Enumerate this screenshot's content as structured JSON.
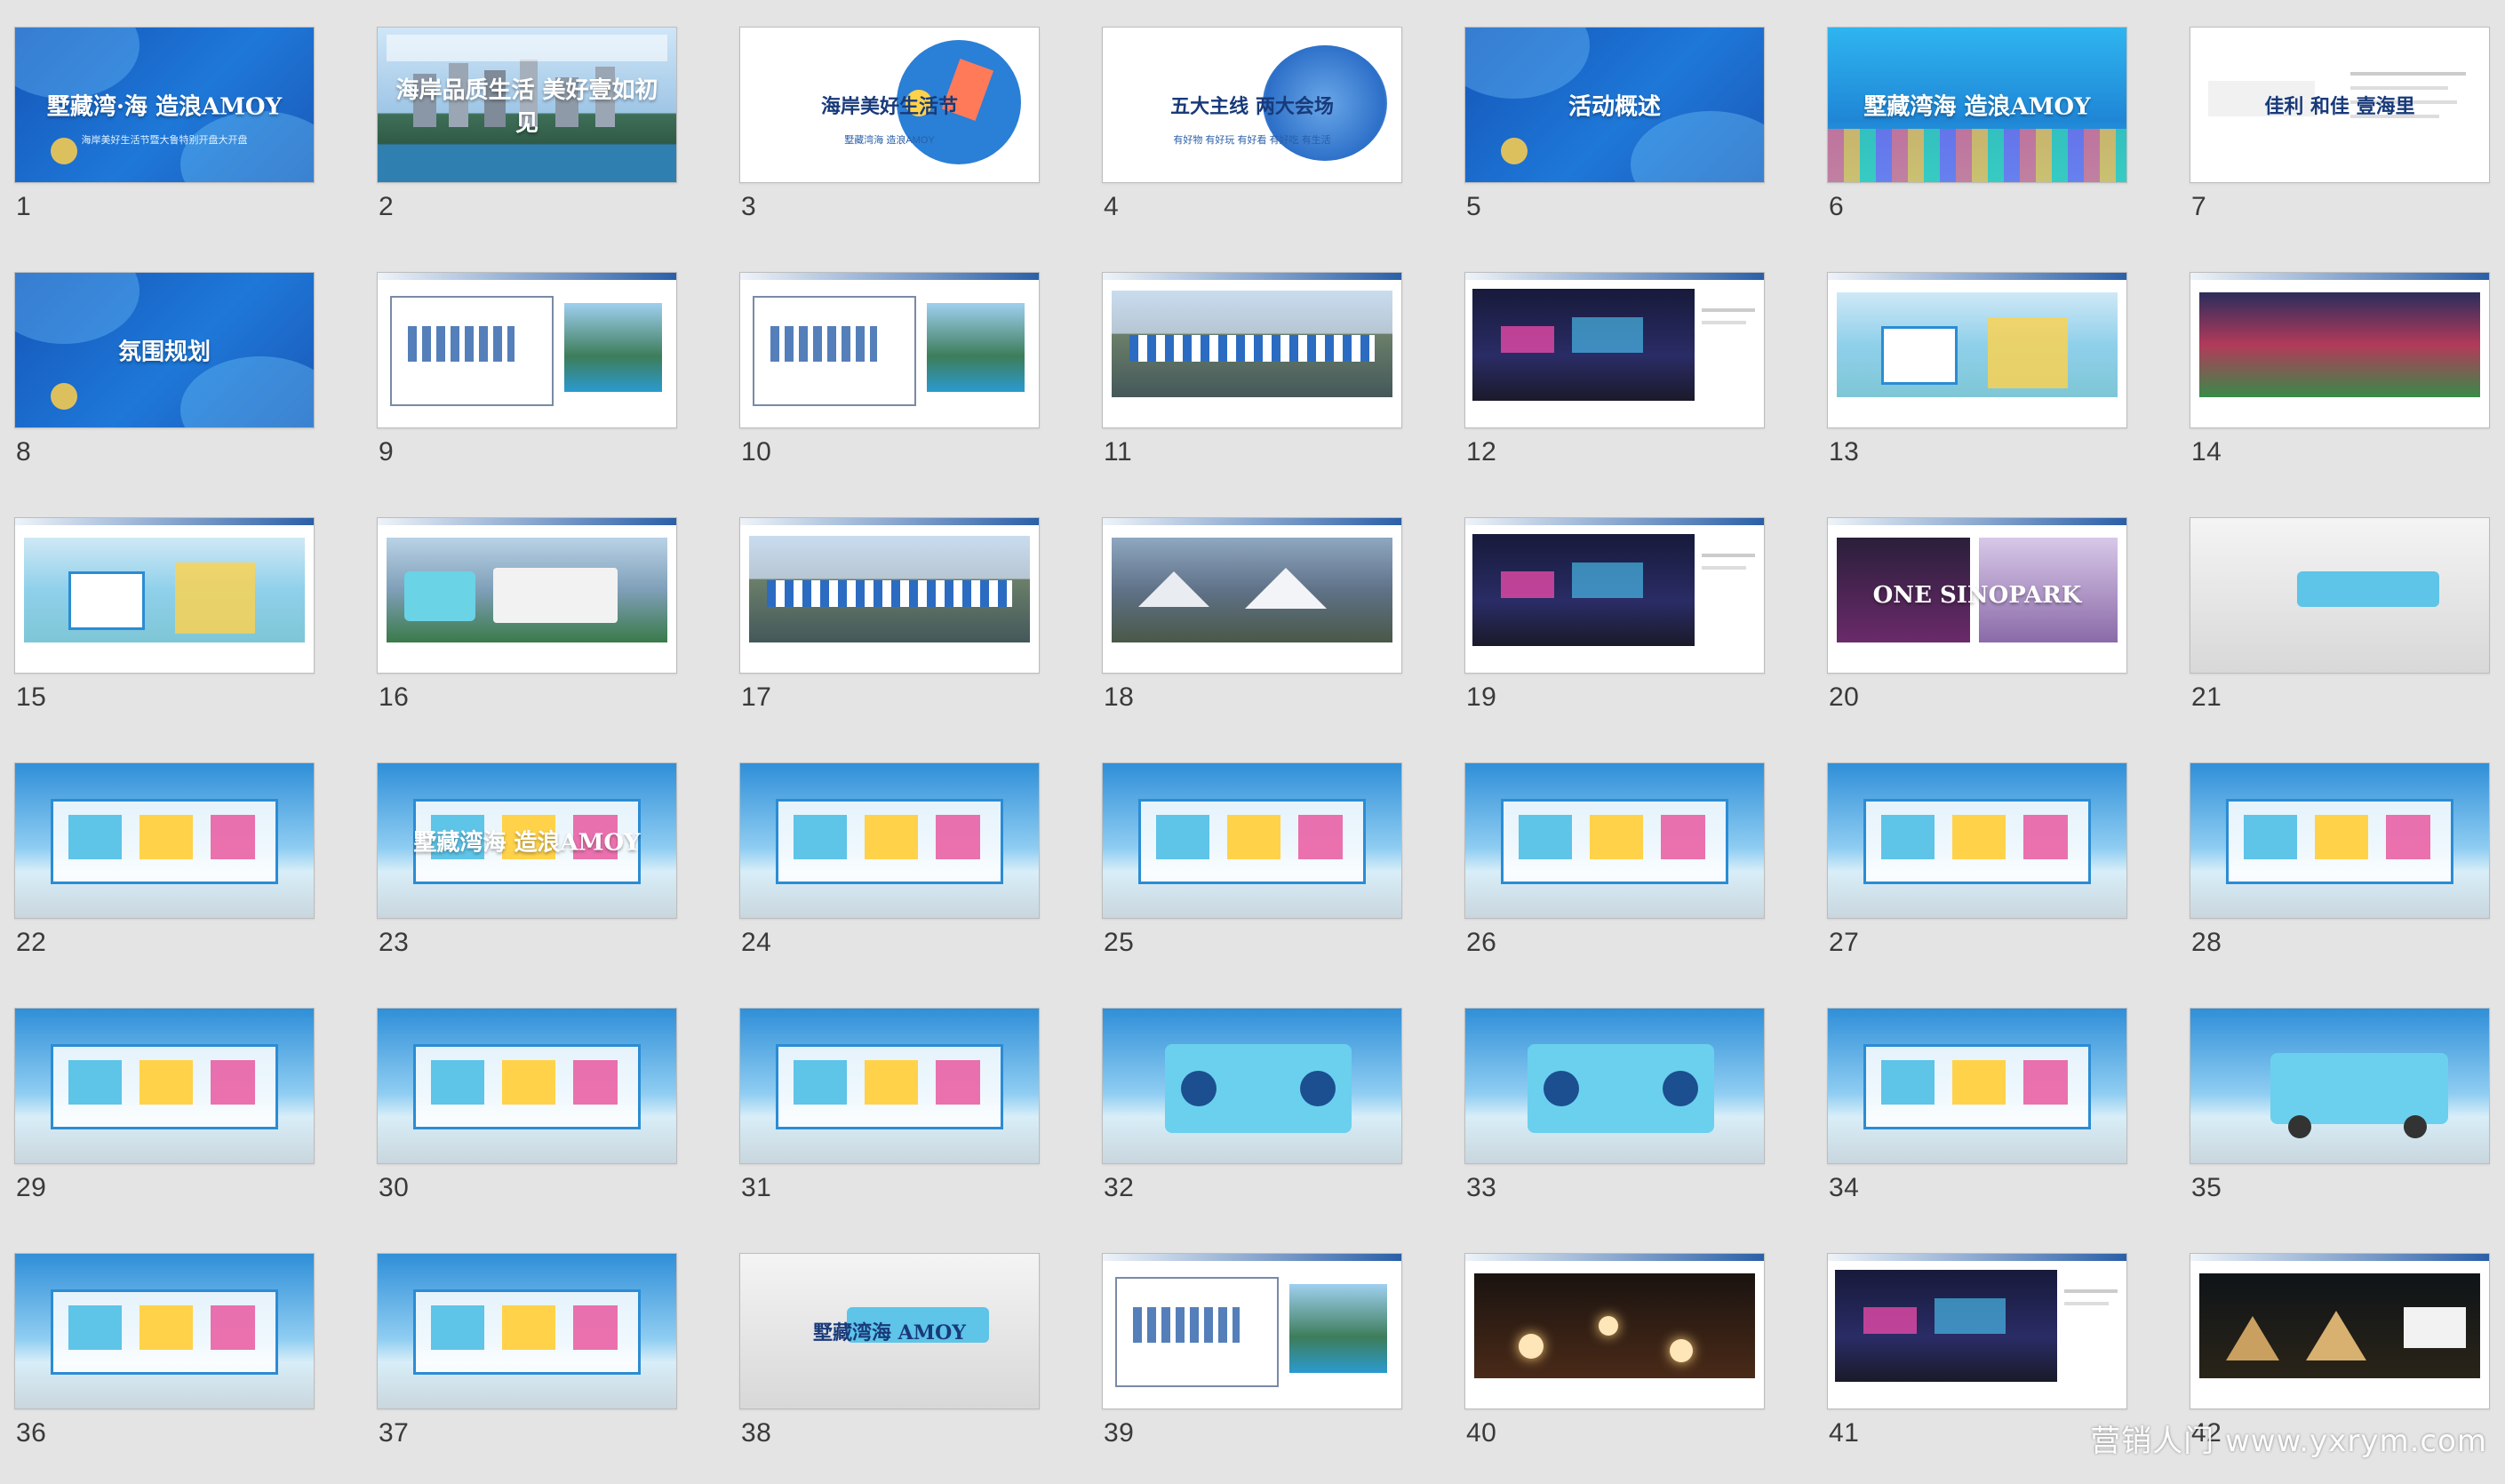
{
  "watermark": "营销人门 www.yxrym.com",
  "colors": {
    "background": "#e4e4e4",
    "brand_blue": "#1b63c6",
    "sky": "#3e9fe0",
    "sea": "#3fb9d8"
  },
  "slides": [
    {
      "number": "1",
      "title": "墅藏湾·海 造浪AMOY",
      "subtitle": "海岸美好生活节暨大鲁特别开盘大开盘",
      "style": "blue"
    },
    {
      "number": "2",
      "title": "海岸品质生活 美好壹如初见",
      "subtitle": "",
      "style": "photo-city"
    },
    {
      "number": "3",
      "title": "海岸美好生活节",
      "subtitle": "墅藏湾海 造浪AMOY",
      "style": "white-art"
    },
    {
      "number": "4",
      "title": "五大主线 两大会场",
      "subtitle": "有好物 有好玩 有好看 有好吃 有生活",
      "style": "white-text"
    },
    {
      "number": "5",
      "title": "活动概述",
      "subtitle": "",
      "style": "blue"
    },
    {
      "number": "6",
      "title": "墅藏湾海 造浪AMOY",
      "subtitle": "",
      "style": "cyan"
    },
    {
      "number": "7",
      "title": "佳利 和佳 壹海里",
      "subtitle": "",
      "style": "white-doc"
    },
    {
      "number": "8",
      "title": "氛围规划",
      "subtitle": "",
      "style": "blue"
    },
    {
      "number": "9",
      "title": "",
      "subtitle": "",
      "style": "plan"
    },
    {
      "number": "10",
      "title": "",
      "subtitle": "",
      "style": "plan"
    },
    {
      "number": "11",
      "title": "",
      "subtitle": "",
      "style": "photo-market"
    },
    {
      "number": "12",
      "title": "",
      "subtitle": "",
      "style": "photo-night"
    },
    {
      "number": "13",
      "title": "",
      "subtitle": "",
      "style": "photo-booth"
    },
    {
      "number": "14",
      "title": "",
      "subtitle": "",
      "style": "photo-fair"
    },
    {
      "number": "15",
      "title": "",
      "subtitle": "",
      "style": "photo-booth"
    },
    {
      "number": "16",
      "title": "",
      "subtitle": "",
      "style": "photo-truck"
    },
    {
      "number": "17",
      "title": "",
      "subtitle": "",
      "style": "photo-market"
    },
    {
      "number": "18",
      "title": "",
      "subtitle": "",
      "style": "photo-tents"
    },
    {
      "number": "19",
      "title": "",
      "subtitle": "",
      "style": "photo-night"
    },
    {
      "number": "20",
      "title": "ONE SINOPARK",
      "subtitle": "",
      "style": "photo-sign"
    },
    {
      "number": "21",
      "title": "",
      "subtitle": "",
      "style": "render-grey"
    },
    {
      "number": "22",
      "title": "",
      "subtitle": "",
      "style": "render-sky"
    },
    {
      "number": "23",
      "title": "墅藏湾海 造浪AMOY",
      "subtitle": "",
      "style": "render-sky"
    },
    {
      "number": "24",
      "title": "",
      "subtitle": "",
      "style": "render-sky"
    },
    {
      "number": "25",
      "title": "",
      "subtitle": "",
      "style": "render-sky"
    },
    {
      "number": "26",
      "title": "",
      "subtitle": "",
      "style": "render-sky"
    },
    {
      "number": "27",
      "title": "",
      "subtitle": "",
      "style": "render-sky"
    },
    {
      "number": "28",
      "title": "",
      "subtitle": "",
      "style": "render-sky"
    },
    {
      "number": "29",
      "title": "",
      "subtitle": "",
      "style": "render-sky"
    },
    {
      "number": "30",
      "title": "",
      "subtitle": "",
      "style": "render-sky"
    },
    {
      "number": "31",
      "title": "",
      "subtitle": "",
      "style": "render-sky"
    },
    {
      "number": "32",
      "title": "",
      "subtitle": "",
      "style": "render-radio"
    },
    {
      "number": "33",
      "title": "",
      "subtitle": "",
      "style": "render-radio"
    },
    {
      "number": "34",
      "title": "",
      "subtitle": "",
      "style": "render-sky"
    },
    {
      "number": "35",
      "title": "",
      "subtitle": "",
      "style": "render-truck"
    },
    {
      "number": "36",
      "title": "",
      "subtitle": "",
      "style": "render-sky"
    },
    {
      "number": "37",
      "title": "",
      "subtitle": "",
      "style": "render-sky"
    },
    {
      "number": "38",
      "title": "墅藏湾海 AMOY",
      "subtitle": "",
      "style": "render-grey"
    },
    {
      "number": "39",
      "title": "",
      "subtitle": "",
      "style": "plan"
    },
    {
      "number": "40",
      "title": "",
      "subtitle": "",
      "style": "photo-lights"
    },
    {
      "number": "41",
      "title": "",
      "subtitle": "",
      "style": "photo-night"
    },
    {
      "number": "42",
      "title": "",
      "subtitle": "",
      "style": "photo-tents-night"
    }
  ]
}
